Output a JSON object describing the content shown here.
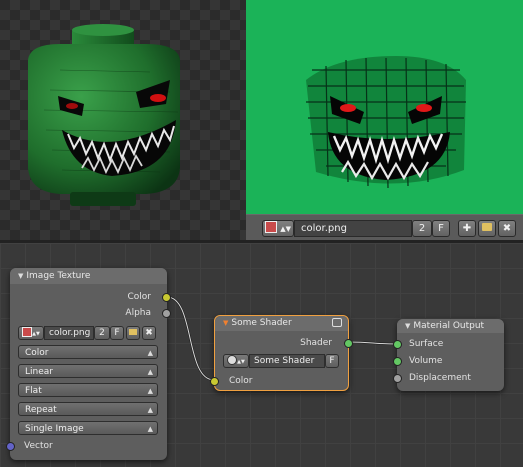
{
  "image_editor": {
    "image_name": "color.png",
    "users": "2",
    "fake_user": "F"
  },
  "nodes": {
    "image_texture": {
      "title": "Image Texture",
      "out_color": "Color",
      "out_alpha": "Alpha",
      "image_name": "color.png",
      "users": "2",
      "fake_user": "F",
      "color_space": "Color",
      "interpolation": "Linear",
      "projection": "Flat",
      "extension": "Repeat",
      "source": "Single Image",
      "in_vector": "Vector"
    },
    "some_shader": {
      "title": "Some Shader",
      "out_shader": "Shader",
      "group_name": "Some Shader",
      "fake_user": "F",
      "in_color": "Color"
    },
    "material_output": {
      "title": "Material Output",
      "in_surface": "Surface",
      "in_volume": "Volume",
      "in_displacement": "Displacement"
    }
  },
  "colors": {
    "image_bg": "#1bb358",
    "socket_color": "#c8c832",
    "socket_shader": "#63c763",
    "socket_vector": "#6363c7"
  }
}
